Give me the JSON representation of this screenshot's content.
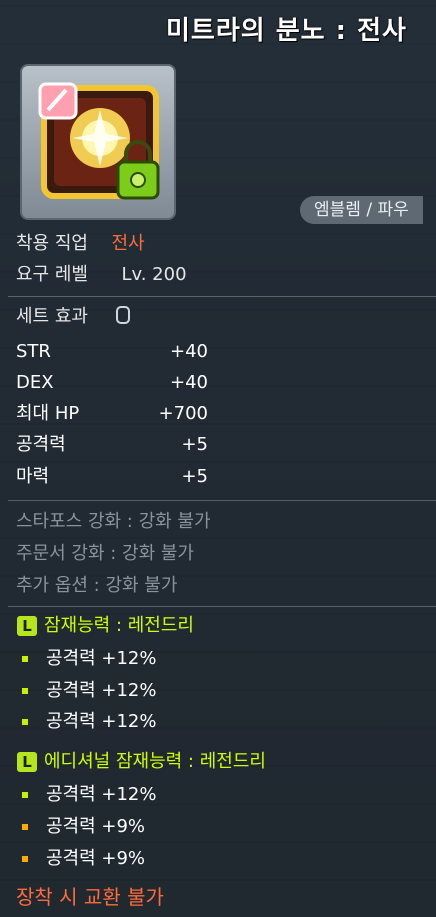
{
  "item": {
    "title": "미트라의 분노 : 전사",
    "category_chip": "엠블렘 / 파우"
  },
  "requirements": {
    "job_label": "착용 직업",
    "job_value": "전사",
    "level_label": "요구 레벨",
    "level_value": "Lv. 200"
  },
  "set_effect": {
    "label": "세트 효과",
    "stats": [
      {
        "name": "STR",
        "value": "+40"
      },
      {
        "name": "DEX",
        "value": "+40"
      },
      {
        "name": "최대 HP",
        "value": "+700"
      },
      {
        "name": "공격력",
        "value": "+5"
      },
      {
        "name": "마력",
        "value": "+5"
      }
    ]
  },
  "enhancements": [
    "스타포스 강화 : 강화 불가",
    "주문서 강화 : 강화 불가",
    "추가 옵션 : 강화 불가"
  ],
  "potential": {
    "badge": "L",
    "header": "잠재능력 : 레전드리",
    "lines": [
      "공격력 +12%",
      "공격력 +12%",
      "공격력 +12%"
    ]
  },
  "additional_potential": {
    "badge": "L",
    "header": "에디셔널 잠재능력 : 레전드리",
    "lines": [
      "공격력 +12%",
      "공격력 +9%",
      "공격력 +9%"
    ]
  },
  "footer": "장착 시 교환 불가",
  "colors": {
    "legendary": "#ccff00",
    "job_highlight": "#ff6b3a",
    "bullet_green": "#c8f000",
    "bullet_orange": "#ffaa00"
  },
  "icons": [
    "emblem-item-icon",
    "lock-icon",
    "set-lock-icon"
  ]
}
